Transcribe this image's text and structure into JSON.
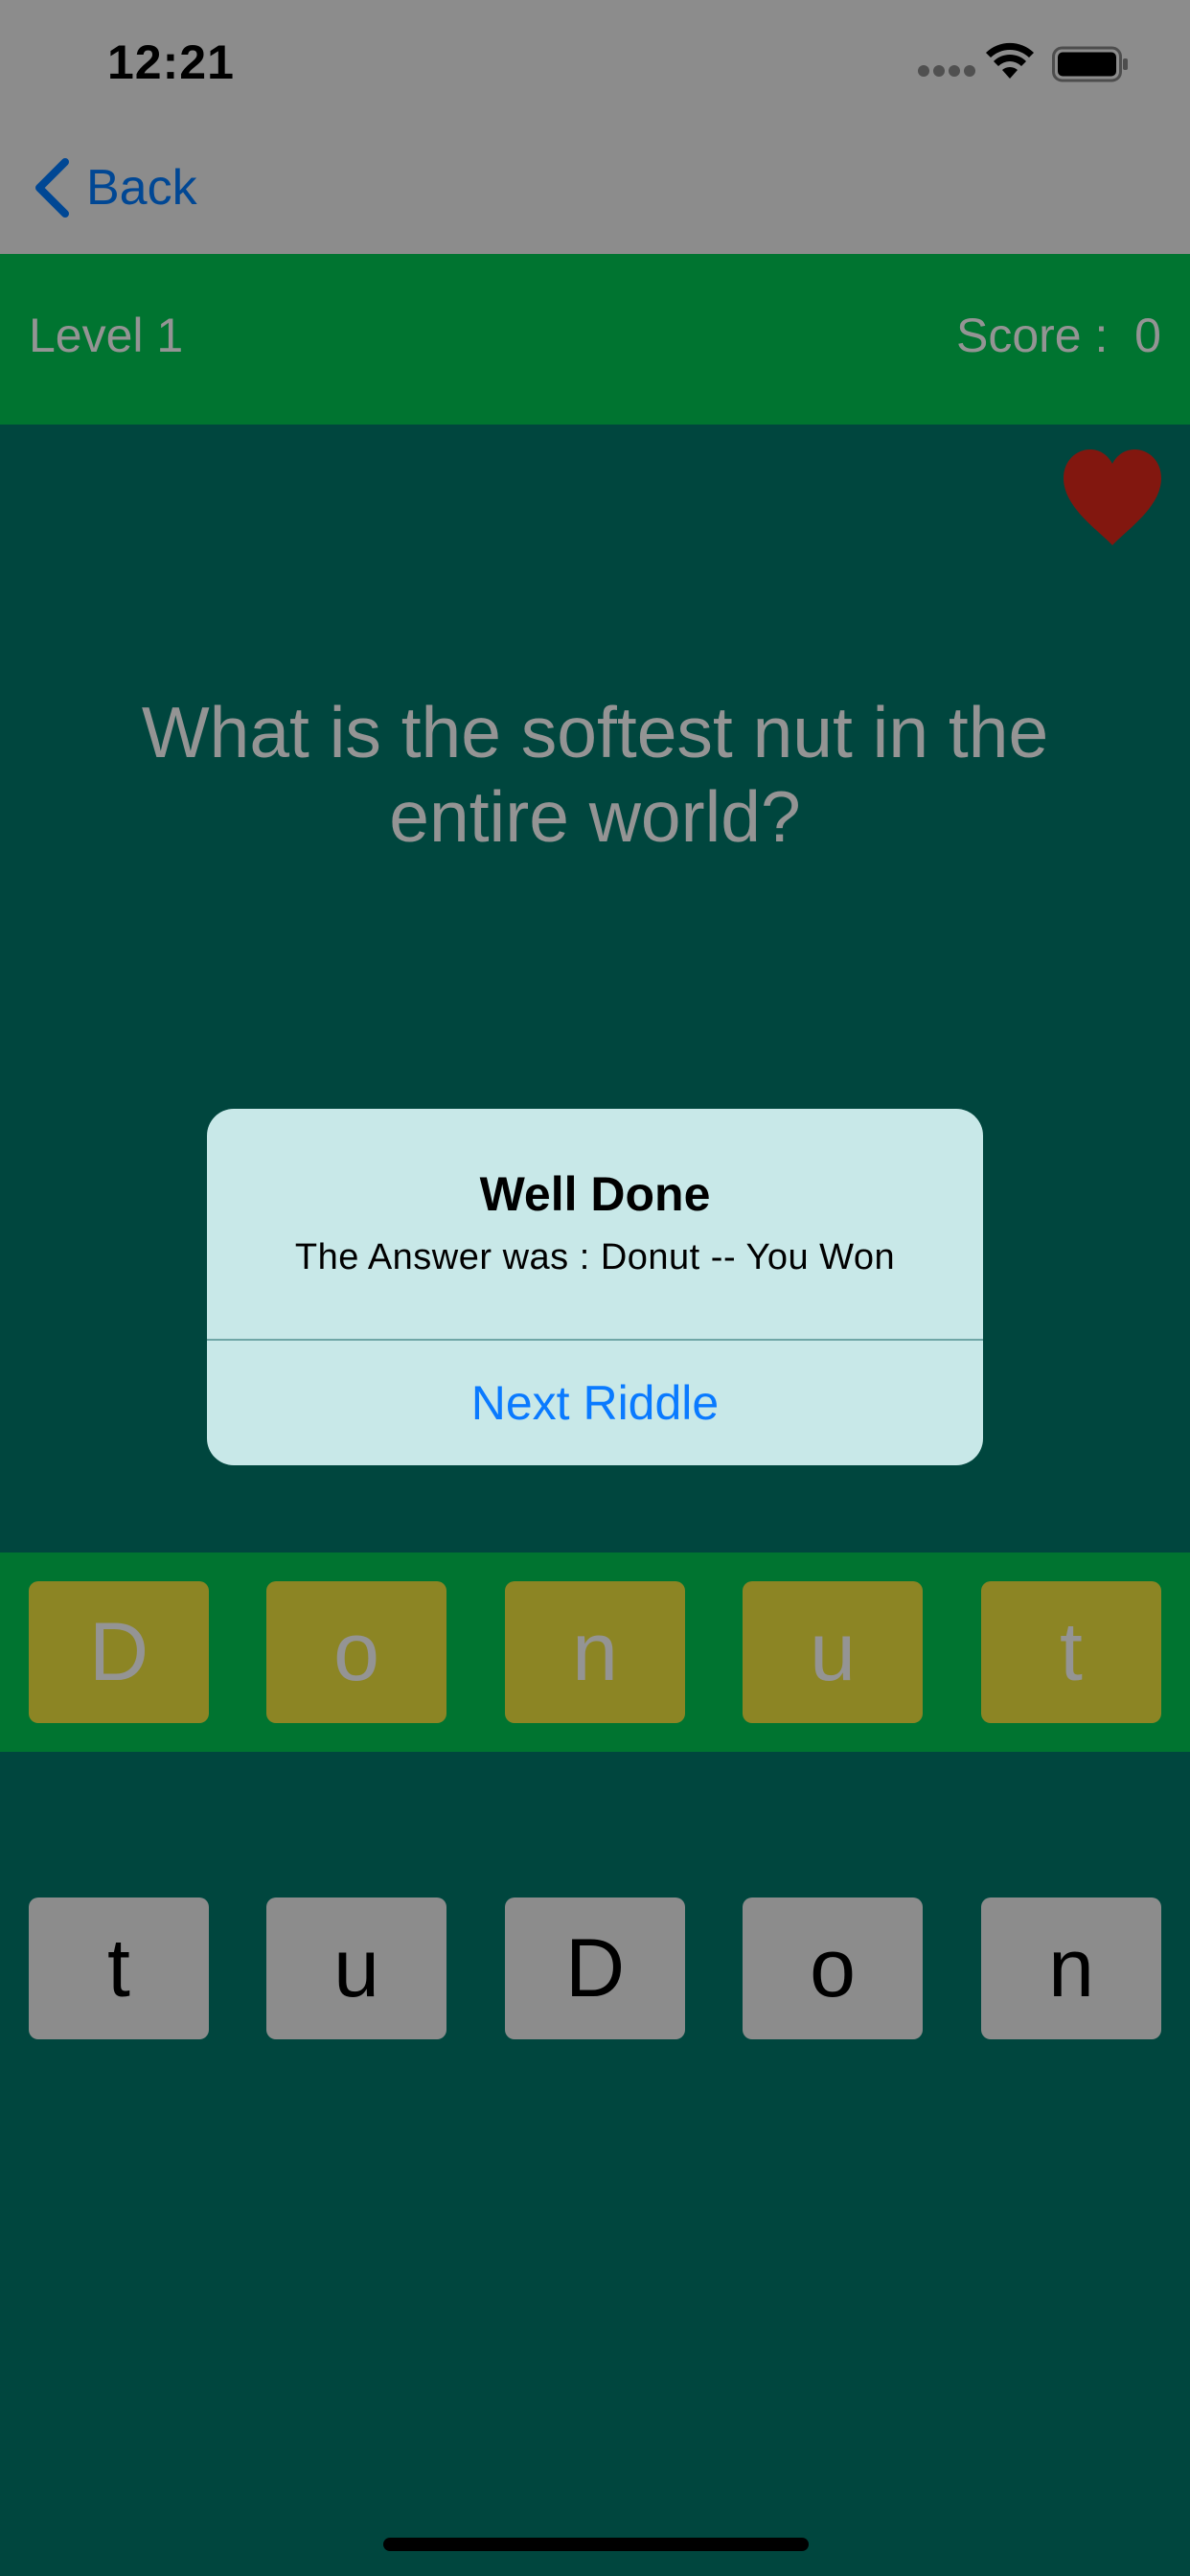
{
  "status_bar": {
    "time": "12:21"
  },
  "nav": {
    "back_label": "Back",
    "back_icon": "chevron-left-icon"
  },
  "game": {
    "level_label": "Level 1",
    "score_label": "Score :  0",
    "heart_icon": "heart-icon",
    "riddle": "What is the softest nut in the entire world?",
    "answer_tiles": [
      "D",
      "o",
      "n",
      "u",
      "t"
    ],
    "letter_tiles": [
      "t",
      "u",
      "D",
      "o",
      "n"
    ]
  },
  "alert": {
    "title": "Well Done",
    "message": "The Answer was : Donut -- You Won",
    "button_label": "Next Riddle"
  },
  "colors": {
    "background": "#00796b",
    "level_bar": "#00c853",
    "answer_tile": "#f2e53f",
    "letter_tile": "#f2f2f2",
    "heart": "#e0281a",
    "alert_bg": "#c8e8e8",
    "alert_button": "#0a7aff"
  }
}
